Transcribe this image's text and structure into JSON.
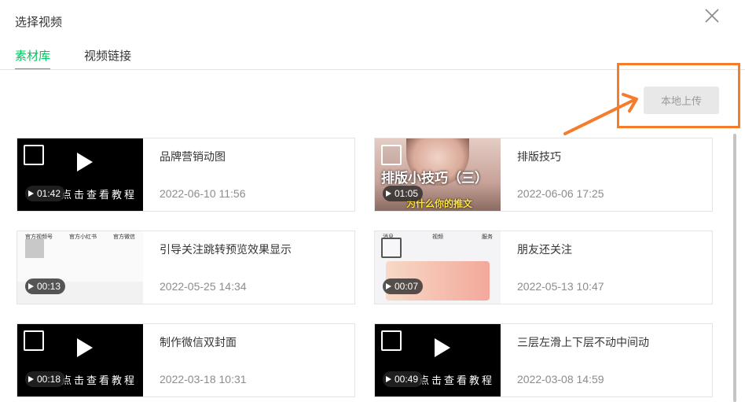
{
  "dialog": {
    "title": "选择视频",
    "close_icon": "close-icon"
  },
  "tabs": [
    {
      "label": "素材库",
      "active": true
    },
    {
      "label": "视频链接",
      "active": false
    }
  ],
  "upload_button": "本地上传",
  "annotation": {
    "color": "#f47c2a"
  },
  "colors": {
    "accent": "#07c160",
    "border": "#e4e4e4"
  },
  "videos": [
    {
      "title": "品牌营销动图",
      "date": "2022-06-10 11:56",
      "duration": "01:42",
      "thumb": "black",
      "caption": "点击查看教程"
    },
    {
      "title": "排版技巧",
      "date": "2022-06-06 17:25",
      "duration": "01:05",
      "thumb": "pink",
      "overlay_title": "排版小技巧（三）",
      "overlay_sub": "为什么你的推文"
    },
    {
      "title": "引导关注跳转预览效果显示",
      "date": "2022-05-25 14:34",
      "duration": "00:13",
      "thumb": "white",
      "mini_header": [
        "官方视频号",
        "官方小红书",
        "官方微信"
      ]
    },
    {
      "title": "朋友还关注",
      "date": "2022-05-13 10:47",
      "duration": "00:07",
      "thumb": "app",
      "mini_header": [
        "消息",
        "视频",
        "服务"
      ]
    },
    {
      "title": "制作微信双封面",
      "date": "2022-03-18 10:31",
      "duration": "00:18",
      "thumb": "black",
      "caption": "点击查看教程"
    },
    {
      "title": "三层左滑上下层不动中间动",
      "date": "2022-03-08 14:59",
      "duration": "00:49",
      "thumb": "black",
      "caption": "点击查看教程"
    }
  ]
}
